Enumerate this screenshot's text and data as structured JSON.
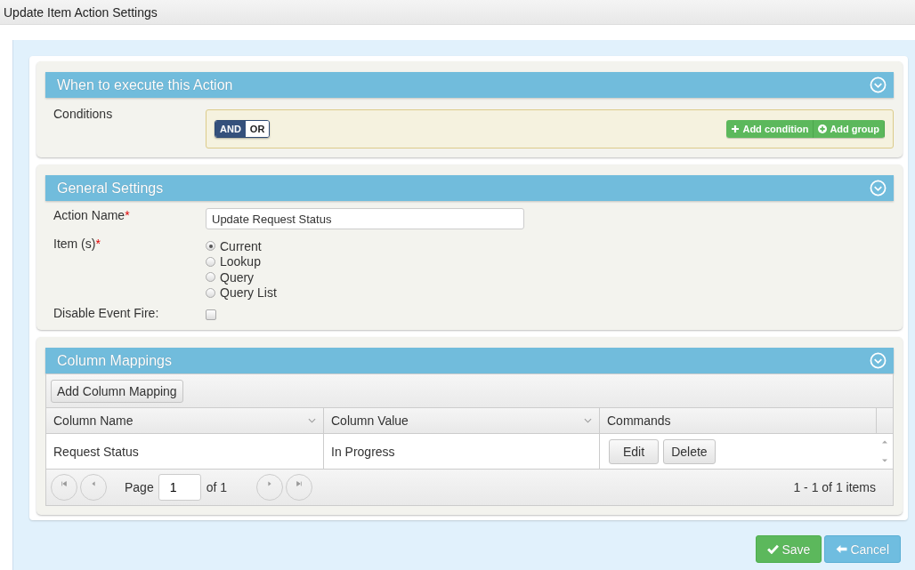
{
  "window": {
    "title": "Update Item Action Settings"
  },
  "conditions_panel": {
    "title": "When to execute this Action",
    "label": "Conditions",
    "logic": [
      {
        "label": "AND",
        "selected": true
      },
      {
        "label": "OR",
        "selected": false
      }
    ],
    "buttons": [
      {
        "label": "Add condition",
        "kind": "plus"
      },
      {
        "label": "Add group",
        "kind": "circle-plus"
      }
    ]
  },
  "general_panel": {
    "title": "General Settings",
    "action_name": {
      "label": "Action Name",
      "required_mark": "*",
      "value": "Update Request Status"
    },
    "items": {
      "label": "Item (s)",
      "required_mark": "*",
      "options": [
        {
          "label": "Current",
          "selected": true
        },
        {
          "label": "Lookup",
          "selected": false
        },
        {
          "label": "Query",
          "selected": false
        },
        {
          "label": "Query List",
          "selected": false
        }
      ]
    },
    "disable_event_fire": {
      "label": "Disable Event Fire:",
      "checked": false
    }
  },
  "mappings_panel": {
    "title": "Column Mappings",
    "add_button": "Add Column Mapping",
    "columns": [
      {
        "label": "Column Name",
        "menu": true
      },
      {
        "label": "Column Value",
        "menu": true
      },
      {
        "label": "Commands",
        "menu": false
      }
    ],
    "rows": [
      {
        "cells": [
          "Request Status",
          "In Progress"
        ],
        "commands": [
          "Edit",
          "Delete"
        ]
      }
    ],
    "pager": {
      "page_label": "Page",
      "page": "1",
      "of_label": "of 1",
      "summary": "1 - 1 of 1 items"
    }
  },
  "footer": {
    "buttons": [
      {
        "label": "Save",
        "kind": "save"
      },
      {
        "label": "Cancel",
        "kind": "cancel"
      }
    ]
  }
}
